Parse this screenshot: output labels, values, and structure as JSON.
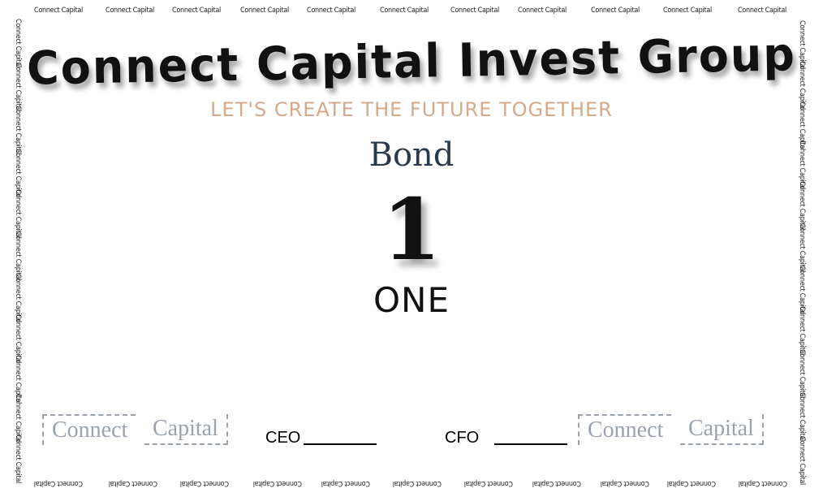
{
  "border": {
    "top": [
      "Connect Capital",
      "Connect Capital",
      "Connect Capital",
      "Connect Capital",
      "Connect Capital",
      "Connect Capital",
      "Connect Capital",
      "Connect Capital",
      "Connect Capital",
      "Connect Capital",
      "Connect Capital"
    ],
    "bottom": [
      "Connect Capital",
      "Connect Capital",
      "Connect Capital",
      "Connect Capital",
      "Connect Capital",
      "Connect Capital",
      "Connect Capital",
      "Connect Capital",
      "Connect Capital",
      "Connect Capital",
      "Connect Capital"
    ],
    "left": [
      "Connect Capital",
      "Connect Capital",
      "Connect Capital",
      "Connect Capital",
      "Connect Capital",
      "Connect Capital",
      "Connect Capital",
      "Connect Capital",
      "Connect Capital",
      "Connect Capital",
      "Connect Capital"
    ],
    "right": [
      "Connect Capital",
      "Connect Capital",
      "Connect Capital",
      "Connect Capital",
      "Connect Capital",
      "Connect Capital",
      "Connect Capital",
      "Connect Capital",
      "Connect Capital",
      "Connect Capital",
      "Connect Capital"
    ]
  },
  "certificate": {
    "company": "Connect Capital Invest Group",
    "tagline": "LET'S CREATE THE FUTURE TOGETHER",
    "doc_type": "Bond",
    "amount_number": "1",
    "amount_words": "ONE"
  },
  "seals": {
    "left": {
      "word1": "Connect",
      "word2": "Capital"
    },
    "right": {
      "word1": "Connect",
      "word2": "Capital"
    }
  },
  "signatures": {
    "ceo_label": "CEO",
    "cfo_label": "CFO"
  },
  "colors": {
    "tagline": "#d5a989",
    "doc_type": "#2a3a4e",
    "seal": "#9aa3ad"
  }
}
